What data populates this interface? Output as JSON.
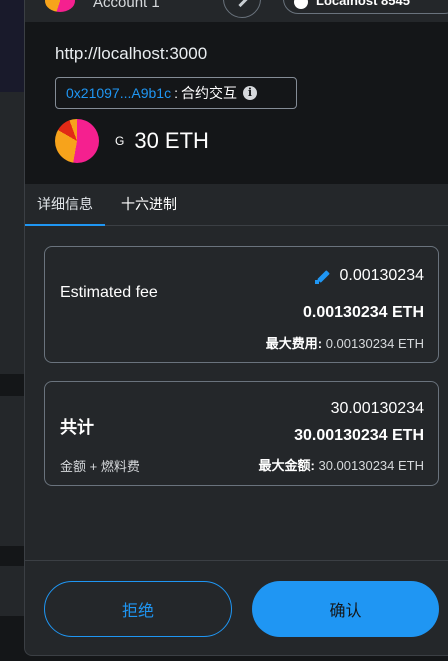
{
  "top_bar": {
    "account_name": "Account 1",
    "network_label": "Localhost 8545"
  },
  "header": {
    "origin": "http://localhost:3000",
    "contract": {
      "address": "0x21097...A9b1c",
      "separator": ":",
      "label": "合约交互",
      "info_icon": "i"
    },
    "asset": {
      "letter": "G",
      "amount": "30 ETH"
    }
  },
  "tabs": [
    {
      "label": "详细信息",
      "active": true
    },
    {
      "label": "十六进制",
      "active": false
    }
  ],
  "fee_card": {
    "label": "Estimated fee",
    "secondary_value": "0.00130234",
    "primary_value": "0.00130234 ETH",
    "max_label": "最大费用:",
    "max_value": "0.00130234 ETH"
  },
  "total_card": {
    "label": "共计",
    "sub_label": "金额 + 燃料费",
    "secondary_value": "30.00130234",
    "primary_value": "30.00130234 ETH",
    "max_label": "最大金额:",
    "max_value": "30.00130234 ETH"
  },
  "footer": {
    "reject_label": "拒绝",
    "confirm_label": "确认"
  },
  "colors": {
    "accent": "#1f96f3",
    "background": "#24272a",
    "header_background": "#141618"
  }
}
